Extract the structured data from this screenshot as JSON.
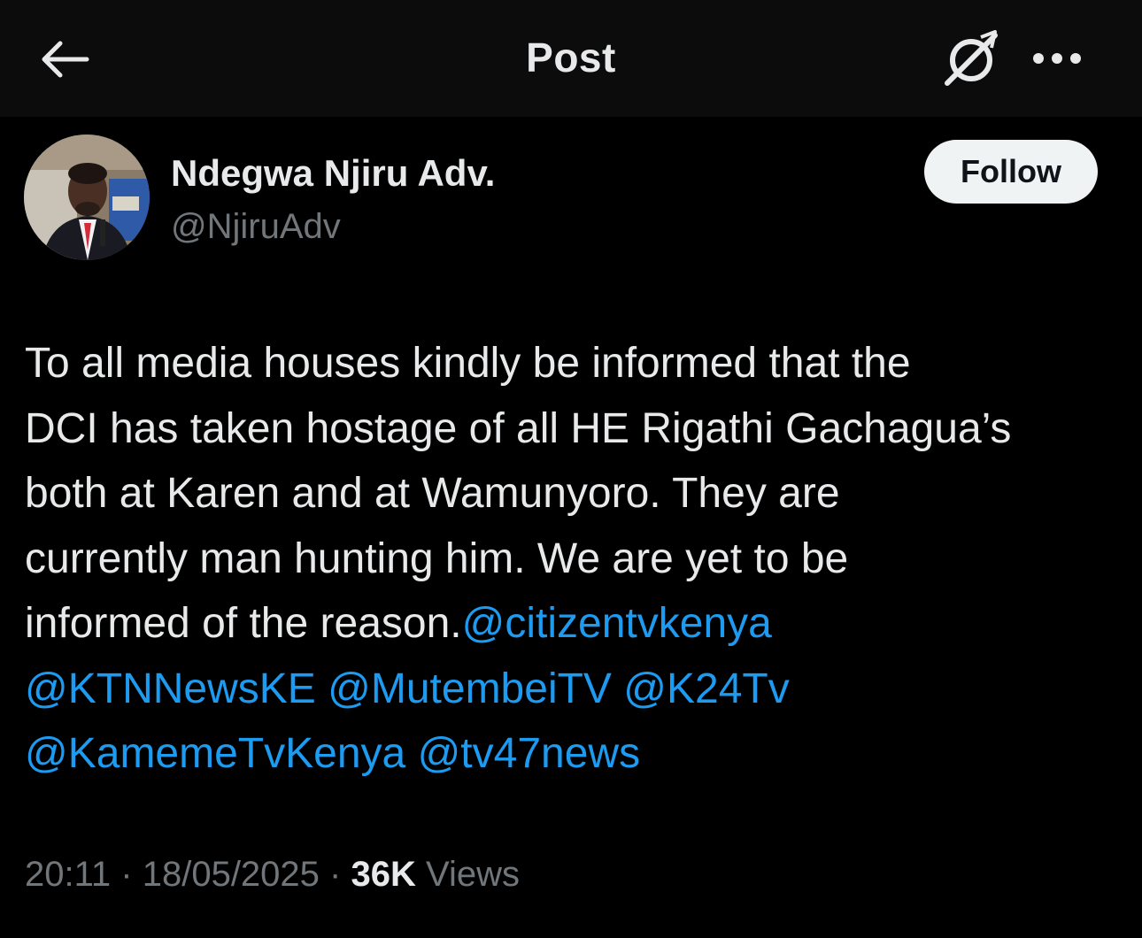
{
  "header": {
    "title": "Post",
    "back_icon": "arrow-left-icon",
    "grok_icon": "grok-icon",
    "more_icon": "more-dots-icon"
  },
  "author": {
    "display_name": "Ndegwa Njiru Adv.",
    "handle": "@NjiruAdv",
    "follow_label": "Follow"
  },
  "tweet": {
    "lines": [
      "To all media houses kindly be informed that the",
      "DCI has taken hostage of all HE Rigathi Gachagua’s",
      "both at Karen and at Wamunyoro. They are",
      "currently man hunting him. We are yet to be",
      "informed of the reason."
    ],
    "mentions": [
      "@citizentvkenya",
      "@KTNNewsKE",
      "@MutembeiTV",
      "@K24Tv",
      "@KamemeTvKenya",
      "@tv47news"
    ]
  },
  "meta": {
    "time": "20:11",
    "separator": "·",
    "date": "18/05/2025",
    "views_count": "36K",
    "views_label": "Views"
  },
  "colors": {
    "background": "#000000",
    "header_bg": "#0c0c0c",
    "text_primary": "#e7e9ea",
    "text_secondary": "#71767b",
    "link": "#1d9bf0",
    "follow_bg": "#eff3f4"
  }
}
